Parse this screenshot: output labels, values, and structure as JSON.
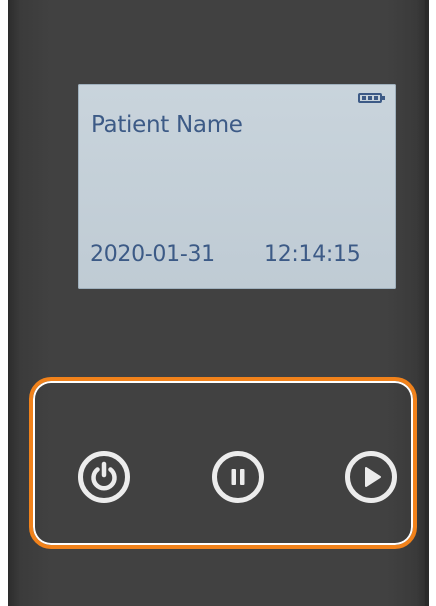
{
  "screen": {
    "patient_name": "Patient Name",
    "date": "2020-01-31",
    "time": "12:14:15",
    "battery_icon": "battery-full-icon"
  },
  "controls": {
    "buttons": [
      {
        "name": "power",
        "icon": "power-icon"
      },
      {
        "name": "pause",
        "icon": "pause-icon"
      },
      {
        "name": "play",
        "icon": "play-icon"
      }
    ],
    "highlight_color": "#f1821b"
  },
  "colors": {
    "device_body": "#414141",
    "lcd_background": "#c9d4dc",
    "lcd_text": "#3c5a86",
    "button_icon": "#ececec"
  }
}
